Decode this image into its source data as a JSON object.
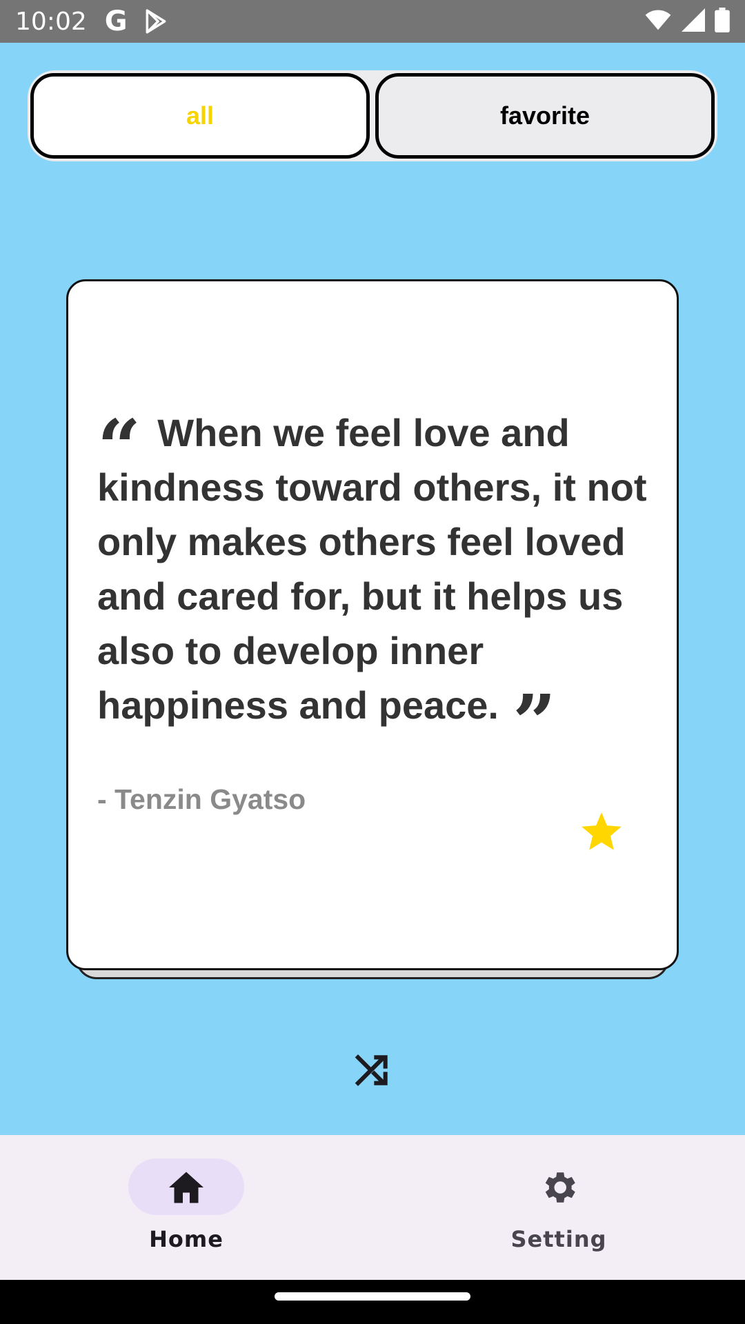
{
  "status_bar": {
    "time": "10:02",
    "g_label": "G",
    "icons": [
      "google-icon",
      "play-store-icon",
      "wifi-icon",
      "signal-icon",
      "battery-icon"
    ]
  },
  "tabs": {
    "items": [
      {
        "label": "all",
        "selected": true
      },
      {
        "label": "favorite",
        "selected": false
      }
    ],
    "selected_color": "#f5d400"
  },
  "quote_card": {
    "text": "When we feel love and kindness toward others, it not only makes others feel loved and cared for, but it helps us also to develop inner happiness and peace.",
    "author": "- Tenzin Gyatso",
    "open_quote_icon": "open-quote-icon",
    "close_quote_icon": "close-quote-icon",
    "favorite": true,
    "favorite_icon": "star-icon",
    "star_color": "#ffd600"
  },
  "shuffle": {
    "icon": "shuffle-icon"
  },
  "bottom_nav": {
    "items": [
      {
        "label": "Home",
        "icon": "home-icon",
        "active": true
      },
      {
        "label": "Setting",
        "icon": "gear-icon",
        "active": false
      }
    ],
    "active_pill_color": "#e8def8"
  },
  "colors": {
    "background": "#87d4f9",
    "card": "#ffffff",
    "nav_background": "#f3edf6"
  }
}
